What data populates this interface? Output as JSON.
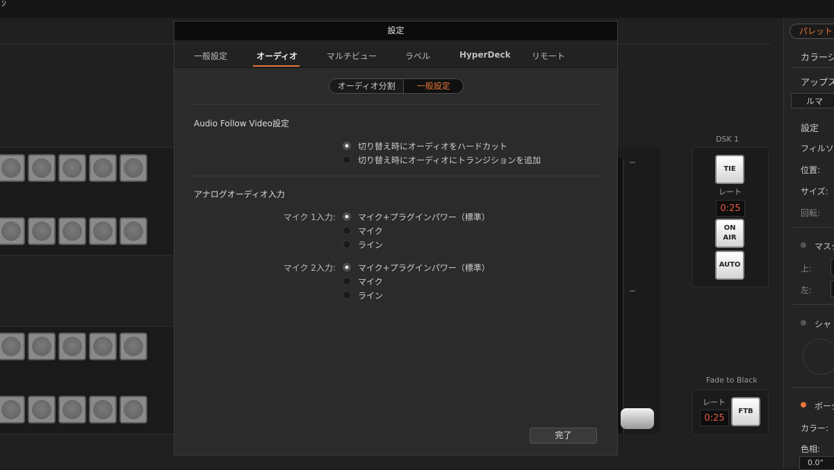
{
  "app": {
    "top_glyph": "ｼﾞ"
  },
  "dsk": {
    "label": "DSK 1",
    "tie": "TIE",
    "rate_label": "レート",
    "rate": "0:25",
    "on_air": "ON AIR",
    "auto": "AUTO"
  },
  "fade_to_black": {
    "label": "Fade to Black",
    "rate_label": "レート",
    "rate": "0:25",
    "ftb": "FTB"
  },
  "palette": {
    "button": "パレット",
    "color_gen": "カラージ",
    "upstream": "アップス",
    "luma": "ルマ",
    "settings": "設定",
    "fill_source": "フィルソー",
    "position": "位置:",
    "size": "サイズ:",
    "rotation": "回転:",
    "mask": "マスク",
    "top": "上:",
    "left": "左:",
    "shadow": "シャ",
    "border": "ボーダ",
    "color": "カラー:",
    "hue": "色相:",
    "hue_value": "0.0°",
    "accent": "#e8773a"
  },
  "dialog": {
    "title": "設定",
    "tabs": [
      "一般設定",
      "オーディオ",
      "マルチビュー",
      "ラベル",
      "HyperDeck",
      "リモート"
    ],
    "active_tab": 1,
    "segment": {
      "left": "オーディオ分割",
      "right": "一般設定",
      "selected": "一般設定"
    },
    "afv": {
      "heading": "Audio Follow Video設定",
      "options": [
        "切り替え時にオーディオをハードカット",
        "切り替え時にオーディオにトランジションを追加"
      ],
      "selected": 0
    },
    "analog": {
      "heading": "アナログオーディオ入力",
      "mic1": {
        "label": "マイク 1入力:",
        "options": [
          "マイク+プラグインパワー（標準）",
          "マイク",
          "ライン"
        ],
        "selected": 0
      },
      "mic2": {
        "label": "マイク 2入力:",
        "options": [
          "マイク+プラグインパワー（標準）",
          "マイク",
          "ライン"
        ],
        "selected": 0
      }
    },
    "done_button": "完了"
  }
}
